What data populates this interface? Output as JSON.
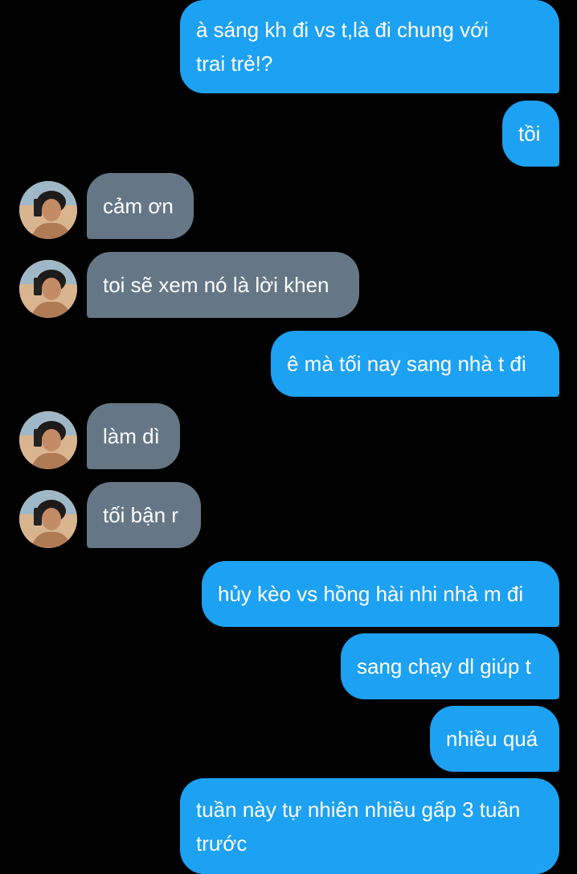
{
  "colors": {
    "background": "#000000",
    "sent_bubble": "#1da1f2",
    "received_bubble": "#657786",
    "text": "#ffffff"
  },
  "avatar_icon": "user-photo-avatar",
  "messages": [
    {
      "direction": "sent",
      "text": "à sáng kh đi vs t,là đi chung với\ntrai trẻ!?"
    },
    {
      "direction": "sent",
      "text": "tồi"
    },
    {
      "direction": "received",
      "text": "cảm ơn"
    },
    {
      "direction": "received",
      "text": "toi sẽ xem nó là lời khen"
    },
    {
      "direction": "sent",
      "text": "ê mà tối nay sang nhà t đi"
    },
    {
      "direction": "received",
      "text": "làm dì"
    },
    {
      "direction": "received",
      "text": "tối bận r"
    },
    {
      "direction": "sent",
      "text": "hủy kèo vs hồng hài nhi nhà m đi"
    },
    {
      "direction": "sent",
      "text": "sang chạy dl giúp t"
    },
    {
      "direction": "sent",
      "text": "nhiều quá"
    },
    {
      "direction": "sent",
      "text": "tuần này tự nhiên nhiều gấp 3 tuần\ntrước"
    }
  ]
}
